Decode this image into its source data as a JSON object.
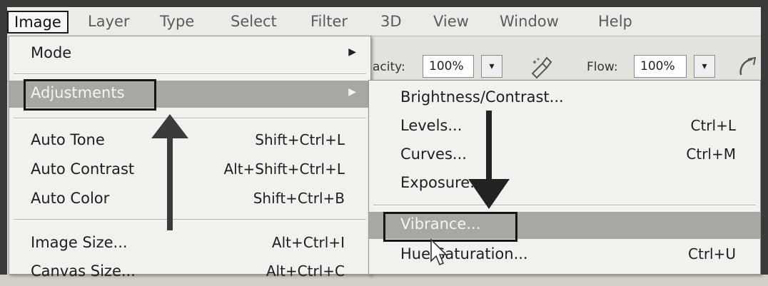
{
  "menubar": {
    "items": [
      "Image",
      "Layer",
      "Type",
      "Select",
      "Filter",
      "3D",
      "View",
      "Window",
      "Help"
    ],
    "active_index": 0
  },
  "options_bar": {
    "opacity_label": "acity:",
    "opacity_value": "100%",
    "flow_label": "Flow:",
    "flow_value": "100%",
    "dropdown_glyph": "▾",
    "icons": [
      "airbrush-icon",
      "pressure-icon"
    ]
  },
  "image_menu": {
    "items": [
      {
        "label": "Mode",
        "shortcut": "",
        "submenu": true
      },
      {
        "label": "Adjustments",
        "shortcut": "",
        "submenu": true,
        "highlighted": true
      },
      {
        "label": "Auto Tone",
        "shortcut": "Shift+Ctrl+L"
      },
      {
        "label": "Auto Contrast",
        "shortcut": "Alt+Shift+Ctrl+L"
      },
      {
        "label": "Auto Color",
        "shortcut": "Shift+Ctrl+B"
      },
      {
        "label": "Image Size...",
        "shortcut": "Alt+Ctrl+I"
      },
      {
        "label": "Canvas Size...",
        "shortcut": "Alt+Ctrl+C"
      }
    ],
    "submenu_glyph": "▶"
  },
  "adjustments_menu": {
    "items": [
      {
        "label": "Brightness/Contrast...",
        "shortcut": ""
      },
      {
        "label": "Levels...",
        "shortcut": "Ctrl+L"
      },
      {
        "label": "Curves...",
        "shortcut": "Ctrl+M"
      },
      {
        "label": "Exposure...",
        "shortcut": ""
      },
      {
        "label": "Vibrance...",
        "shortcut": "",
        "highlighted": true
      },
      {
        "label": "Hue/Saturation...",
        "shortcut": "Ctrl+U"
      }
    ]
  },
  "colors": {
    "highlight": "#a9a7a2",
    "annotation": "#3b3b3b",
    "menu_bg": "#f2f1ee"
  }
}
